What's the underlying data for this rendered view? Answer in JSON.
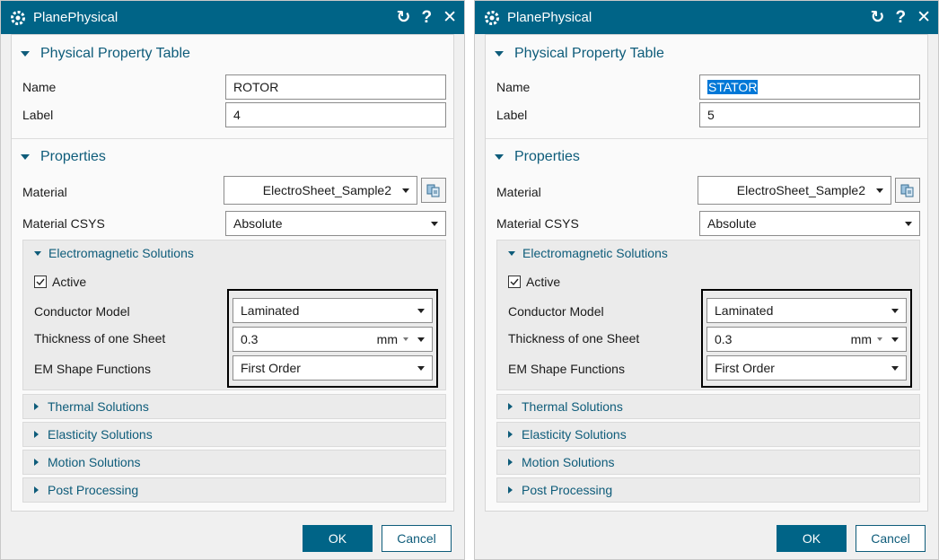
{
  "dialogs": [
    {
      "title": "PlanePhysical",
      "icons": {
        "reset": "↻",
        "help": "?",
        "close": "✕"
      },
      "physical_table": {
        "header": "Physical Property Table",
        "name_label": "Name",
        "name_value": "ROTOR",
        "label_label": "Label",
        "label_value": "4"
      },
      "properties": {
        "header": "Properties",
        "material_label": "Material",
        "material_value": "ElectroSheet_Sample2",
        "csys_label": "Material CSYS",
        "csys_value": "Absolute"
      },
      "em": {
        "header": "Electromagnetic Solutions",
        "active_label": "Active",
        "conductor_label": "Conductor Model",
        "conductor_value": "Laminated",
        "thickness_label": "Thickness of one Sheet",
        "thickness_value": "0.3",
        "thickness_unit": "mm",
        "shape_label": "EM Shape Functions",
        "shape_value": "First Order"
      },
      "subsections": [
        "Thermal Solutions",
        "Elasticity Solutions",
        "Motion Solutions",
        "Post Processing"
      ],
      "buttons": {
        "ok": "OK",
        "cancel": "Cancel"
      }
    },
    {
      "title": "PlanePhysical",
      "icons": {
        "reset": "↻",
        "help": "?",
        "close": "✕"
      },
      "physical_table": {
        "header": "Physical Property Table",
        "name_label": "Name",
        "name_value": "STATOR",
        "label_label": "Label",
        "label_value": "5"
      },
      "properties": {
        "header": "Properties",
        "material_label": "Material",
        "material_value": "ElectroSheet_Sample2",
        "csys_label": "Material CSYS",
        "csys_value": "Absolute"
      },
      "em": {
        "header": "Electromagnetic Solutions",
        "active_label": "Active",
        "conductor_label": "Conductor Model",
        "conductor_value": "Laminated",
        "thickness_label": "Thickness of one Sheet",
        "thickness_value": "0.3",
        "thickness_unit": "mm",
        "shape_label": "EM Shape Functions",
        "shape_value": "First Order"
      },
      "subsections": [
        "Thermal Solutions",
        "Elasticity Solutions",
        "Motion Solutions",
        "Post Processing"
      ],
      "buttons": {
        "ok": "OK",
        "cancel": "Cancel"
      }
    }
  ],
  "colors": {
    "titlebar": "#006487",
    "accent": "#0e5c7a",
    "selection": "#0078d7"
  }
}
